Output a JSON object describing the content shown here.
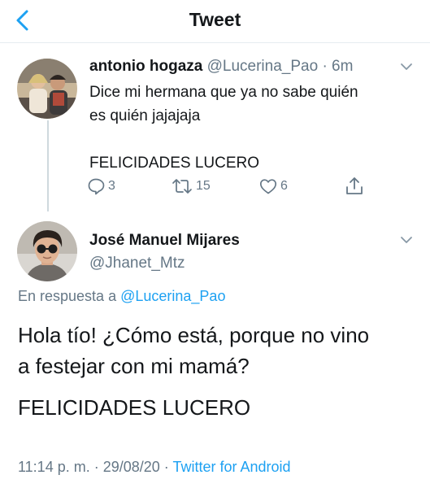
{
  "header": {
    "title": "Tweet",
    "back_icon": "back-chevron-icon"
  },
  "colors": {
    "accent": "#1da1f2",
    "muted": "#657786",
    "text": "#14171a"
  },
  "parent_tweet": {
    "display_name": "antonio hogaza",
    "handle": "@Lucerina_Pao",
    "time": "· 6m",
    "text_line1": "Dice mi hermana que ya no sabe quién",
    "text_line2": "es quién jajajaja",
    "text_line3": "FELICIDADES LUCERO",
    "replies": "3",
    "retweets": "15",
    "likes": "6"
  },
  "main_tweet": {
    "display_name": "José Manuel Mijares",
    "handle": "@Jhanet_Mtz",
    "reply_prefix": "En respuesta a",
    "reply_to": "@Lucerina_Pao",
    "text_line1": "Hola tío! ¿Cómo está, porque no vino",
    "text_line2": "a festejar con mi mamá?",
    "text_para2": "FELICIDADES LUCERO",
    "timestamp": "11:14 p. m. · 29/08/20 ·",
    "source": "Twitter for Android"
  }
}
